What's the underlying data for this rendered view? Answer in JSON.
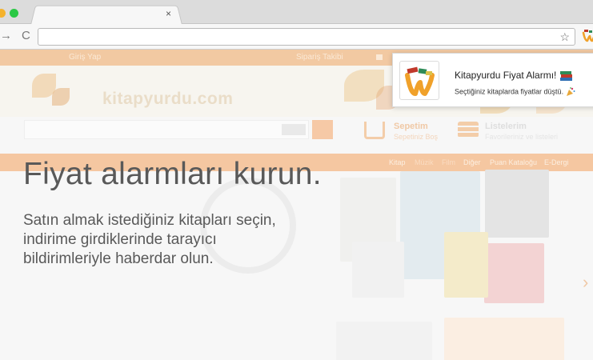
{
  "browser": {
    "tab_close": "×",
    "back_icon": "→",
    "reload_icon": "C",
    "bookmark_icon": "☆"
  },
  "site": {
    "topbar": {
      "left": "Giriş Yap",
      "order_tracking": "Sipariş Takibi"
    },
    "logo": "kitapyurdu.com",
    "cart": {
      "title": "Sepetim",
      "subtitle": "Sepetiniz Boş"
    },
    "lists": {
      "title": "Listelerim",
      "subtitle": "Favorileriniz ve listeleri"
    },
    "nav_categories": [
      "Kitap",
      "Müzik",
      "Film",
      "Diğer",
      "Puan Kataloğu",
      "E-Dergi"
    ]
  },
  "promo": {
    "headline": "Fiyat alarmları kurun.",
    "subtext_lines": [
      "Satın almak istediğiniz kitapları seçin,",
      "indirime girdiklerinde tarayıcı",
      "bildirimleriyle haberdar olun."
    ]
  },
  "notification": {
    "title": "Kitapyurdu Fiyat Alarmı!",
    "body": "Seçtiğiniz kitaplarda fiyatlar düştü."
  },
  "colors": {
    "accent_orange": "#f5a25c",
    "headline_text": "#595959"
  }
}
